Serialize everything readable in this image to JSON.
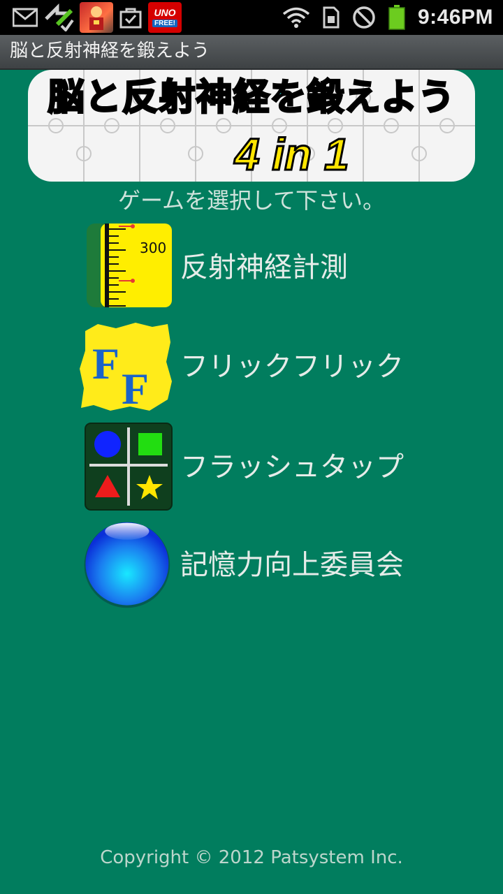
{
  "status_bar": {
    "time": "9:46PM",
    "notification_icons": [
      "gmail-icon",
      "sync-icon",
      "game-app-icon",
      "checkbox-bag-icon",
      "uno-app-icon"
    ],
    "system_icons": [
      "wifi-icon",
      "sim-icon",
      "do-not-disturb-icon",
      "battery-icon"
    ],
    "uno_text": "UNO",
    "uno_sub": "FREE!"
  },
  "title_bar": {
    "title": "脳と反射神経を鍛えよう"
  },
  "banner": {
    "title": "脳と反射神経を鍛えよう",
    "subtitle": "4 in 1"
  },
  "prompt": "ゲームを選択して下さい。",
  "menu": [
    {
      "label": "反射神経計測",
      "icon": "ruler-icon",
      "icon_value": "300"
    },
    {
      "label": "フリックフリック",
      "icon": "ff-icon",
      "icon_text": "FF"
    },
    {
      "label": "フラッシュタップ",
      "icon": "shapes-grid-icon"
    },
    {
      "label": "記憶力向上委員会",
      "icon": "blue-orb-icon"
    }
  ],
  "footer": {
    "copyright": "Copyright © 2012 Patsystem Inc."
  },
  "colors": {
    "background": "#017d5e",
    "title_bar": "#4a4e50",
    "banner_title": "#23d9e0",
    "banner_sub": "#ffe600"
  }
}
